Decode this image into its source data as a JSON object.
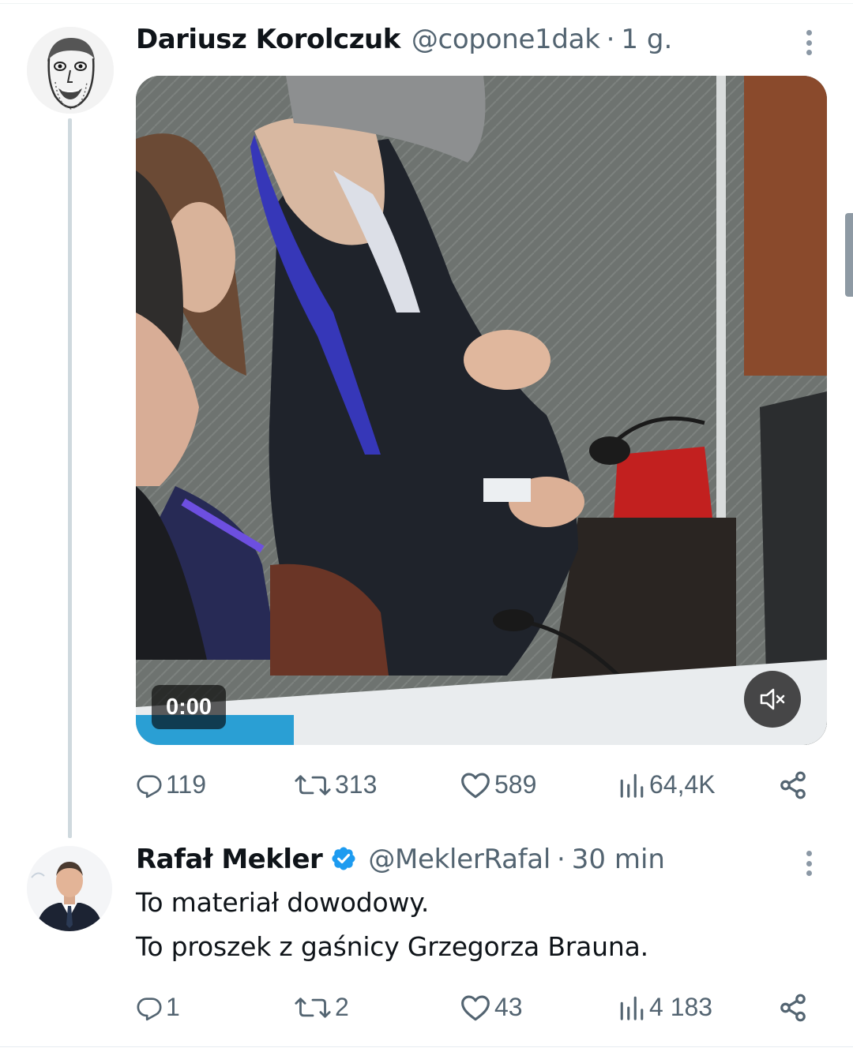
{
  "tweets": [
    {
      "name": "Dariusz Korolczuk",
      "handle": "@copone1dak",
      "separator": "·",
      "time": "1 g.",
      "media": {
        "type": "video",
        "duration_label": "0:00",
        "muted": true
      },
      "stats": {
        "replies": "119",
        "reposts": "313",
        "likes": "589",
        "views": "64,4K"
      }
    },
    {
      "name": "Rafał Mekler",
      "verified": true,
      "handle": "@MeklerRafal",
      "separator": "·",
      "time": "30 min",
      "text": [
        "To materiał dowodowy.",
        "To proszek z gaśnicy Grzegorza Brauna."
      ],
      "stats": {
        "replies": "1",
        "reposts": "2",
        "likes": "43",
        "views": "4 183"
      }
    }
  ],
  "colors": {
    "secondary_text": "#536471",
    "verified": "#1d9bf0",
    "thread_line": "#cfd9de"
  },
  "icons": [
    "reply-icon",
    "repost-icon",
    "like-icon",
    "views-icon",
    "share-icon",
    "more-icon",
    "verified-icon",
    "mute-icon"
  ]
}
